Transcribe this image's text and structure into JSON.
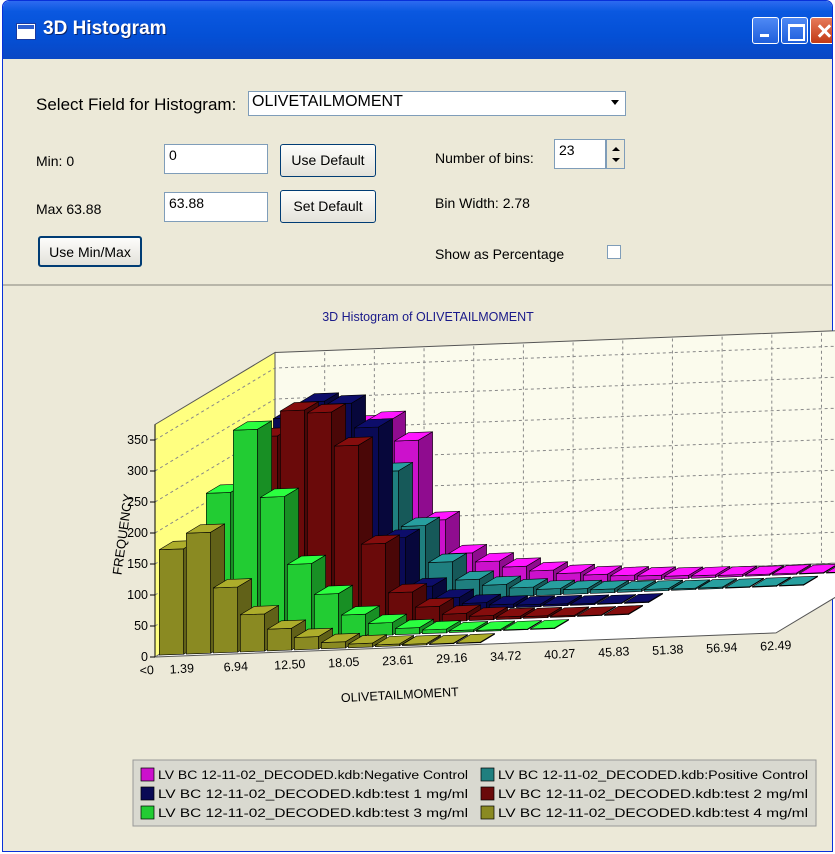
{
  "window": {
    "title": "3D Histogram",
    "icon": "app-window-icon"
  },
  "controls": {
    "field_label": "Select Field for Histogram:",
    "field_value": "OLIVETAILMOMENT",
    "min_label": "Min: 0",
    "min_value": "0",
    "max_label": "Max 63.88",
    "max_value": "63.88",
    "use_default": "Use Default",
    "set_default": "Set Default",
    "use_minmax": "Use Min/Max",
    "bins_label": "Number of bins:",
    "bins_value": "23",
    "bin_width": "Bin Width: 2.78",
    "percentage_label": "Show as Percentage",
    "percentage_checked": false
  },
  "chart_data": {
    "type": "bar",
    "subtype": "3d-histogram",
    "title": "3D Histogram of OLIVETAILMOMENT",
    "xlabel": "OLIVETAILMOMENT",
    "ylabel": "FREQUENCY",
    "ylim": [
      0,
      375
    ],
    "yticks": [
      0,
      50,
      100,
      150,
      200,
      250,
      300,
      350
    ],
    "xtick_labels": [
      "<0",
      "1.39",
      "6.94",
      "12.50",
      "18.05",
      "23.61",
      "29.16",
      "34.72",
      "40.27",
      "45.83",
      "51.38",
      "56.94",
      "62.49"
    ],
    "grid": true,
    "legend_position": "bottom",
    "series": [
      {
        "name": "LV BC 12-11-02_DECODED.kdb:Negative Control",
        "color": "#cc11cc",
        "values": [
          25,
          90,
          220,
          270,
          275,
          240,
          110,
          55,
          40,
          30,
          22,
          16,
          12,
          9,
          7,
          5,
          4,
          3,
          2,
          2,
          1,
          1,
          1
        ]
      },
      {
        "name": "LV BC 12-11-02_DECODED.kdb:Positive Control",
        "color": "#1f7f7f",
        "values": [
          10,
          60,
          160,
          240,
          250,
          210,
          120,
          60,
          30,
          20,
          14,
          10,
          8,
          6,
          4,
          3,
          2,
          2,
          1,
          1,
          1,
          0,
          0
        ]
      },
      {
        "name": "LV BC 12-11-02_DECODED.kdb:test 1 mg/ml",
        "color": "#0a0a55",
        "values": [
          30,
          130,
          320,
          345,
          340,
          300,
          120,
          40,
          20,
          10,
          6,
          4,
          3,
          2,
          1,
          1,
          0,
          0,
          0,
          0,
          0,
          0,
          0
        ]
      },
      {
        "name": "LV BC 12-11-02_DECODED.kdb:test 2 mg/ml",
        "color": "#6a0a0a",
        "values": [
          20,
          120,
          310,
          350,
          345,
          290,
          130,
          50,
          25,
          12,
          7,
          4,
          3,
          2,
          1,
          1,
          0,
          0,
          0,
          0,
          0,
          0,
          0
        ]
      },
      {
        "name": "LV BC 12-11-02_DECODED.kdb:test 3 mg/ml",
        "color": "#22cc33",
        "values": [
          15,
          240,
          340,
          230,
          120,
          70,
          35,
          20,
          10,
          6,
          3,
          2,
          1,
          1,
          0,
          0,
          0,
          0,
          0,
          0,
          0,
          0,
          0
        ]
      },
      {
        "name": "LV BC 12-11-02_DECODED.kdb:test 4 mg/ml",
        "color": "#8a8a22",
        "values": [
          170,
          195,
          105,
          60,
          35,
          20,
          10,
          6,
          3,
          2,
          1,
          1,
          0,
          0,
          0,
          0,
          0,
          0,
          0,
          0,
          0,
          0,
          0
        ]
      }
    ],
    "colors": {
      "back_wall": "#fbfbed",
      "left_wall": "#ffff80",
      "floor": "#ffffff"
    }
  }
}
